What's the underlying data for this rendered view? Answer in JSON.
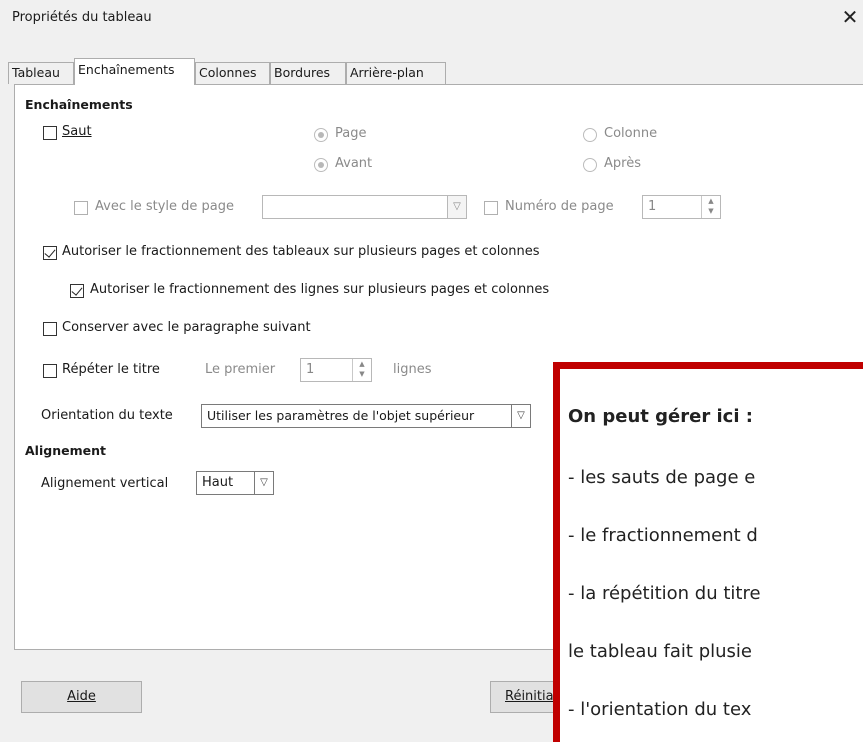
{
  "window": {
    "title": "Propriétés du tableau",
    "close_glyph": "✕"
  },
  "tabs": [
    {
      "label": "Tableau"
    },
    {
      "label": "Enchaînements"
    },
    {
      "label": "Colonnes"
    },
    {
      "label": "Bordures"
    },
    {
      "label": "Arrière-plan"
    }
  ],
  "flow": {
    "section_title": "Enchaînements",
    "saut": {
      "label": "Saut",
      "checked": false
    },
    "radio_page": "Page",
    "radio_colonne": "Colonne",
    "radio_avant": "Avant",
    "radio_apres": "Après",
    "with_page_style": "Avec le style de page",
    "page_style_value": "",
    "page_number": "Numéro de page",
    "page_number_value": "1",
    "split_tables": {
      "label": "Autoriser le fractionnement des tableaux sur plusieurs pages et colonnes",
      "checked": true
    },
    "split_rows": {
      "label": "Autoriser le fractionnement des lignes sur plusieurs pages et colonnes",
      "checked": true
    },
    "keep_with_next": {
      "label": "Conserver avec le paragraphe suivant",
      "checked": false
    },
    "repeat_heading": {
      "label": "Répéter le titre",
      "checked": false
    },
    "first_label": "Le premier",
    "first_value": "1",
    "rows_label": "lignes",
    "text_orientation_label": "Orientation du texte",
    "text_orientation_value": "Utiliser les paramètres de l'objet supérieur"
  },
  "alignment": {
    "section_title": "Alignement",
    "vertical_label": "Alignement vertical",
    "vertical_value": "Haut"
  },
  "buttons": {
    "help": "Aide",
    "reset": "Réinitia"
  },
  "note": {
    "title": "On peut gérer ici :",
    "lines": [
      "- les sauts de page e",
      "- le fractionnement d",
      "- la répétition du titre",
      "le tableau fait plusie",
      "- l'orientation du tex"
    ]
  },
  "colors": {
    "accent_border": "#c00000"
  }
}
